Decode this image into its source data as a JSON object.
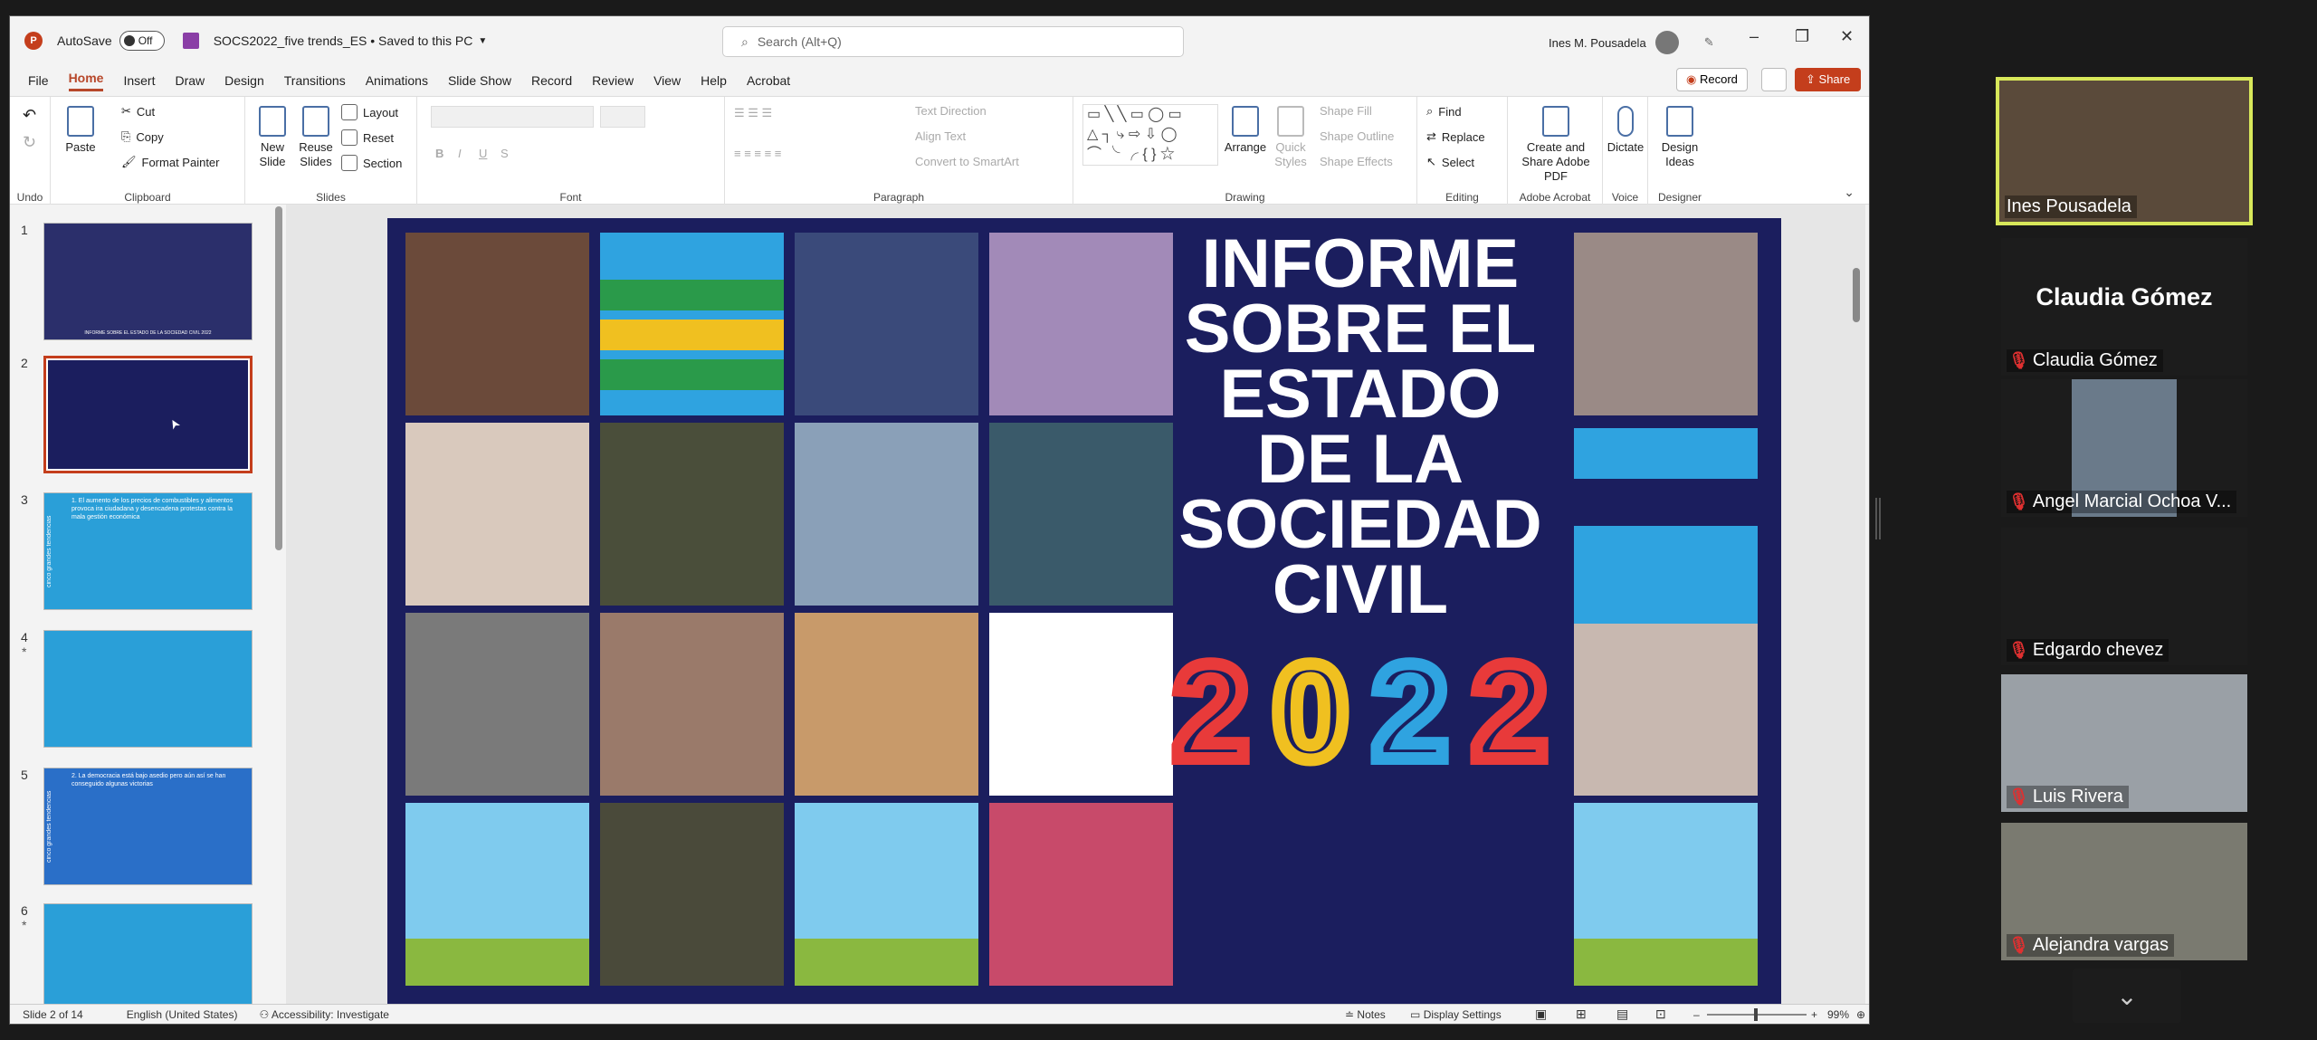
{
  "titlebar": {
    "autosave_label": "AutoSave",
    "autosave_state": "Off",
    "doc_title": "SOCS2022_five trends_ES • Saved to this PC",
    "search_placeholder": "Search (Alt+Q)",
    "user_name": "Ines M. Pousadela"
  },
  "menu": [
    "File",
    "Home",
    "Insert",
    "Draw",
    "Design",
    "Transitions",
    "Animations",
    "Slide Show",
    "Record",
    "Review",
    "View",
    "Help",
    "Acrobat"
  ],
  "menu_active": "Home",
  "actions": {
    "record": "Record",
    "share": "Share"
  },
  "ribbon": {
    "undo": "Undo",
    "clipboard": {
      "label": "Clipboard",
      "paste": "Paste",
      "cut": "Cut",
      "copy": "Copy",
      "format_painter": "Format Painter"
    },
    "slides": {
      "label": "Slides",
      "new_slide": "New Slide",
      "reuse": "Reuse Slides",
      "layout": "Layout",
      "reset": "Reset",
      "section": "Section"
    },
    "font": {
      "label": "Font"
    },
    "paragraph": {
      "label": "Paragraph",
      "text_direction": "Text Direction",
      "align_text": "Align Text",
      "convert_smartart": "Convert to SmartArt"
    },
    "drawing": {
      "label": "Drawing",
      "arrange": "Arrange",
      "quick_styles": "Quick Styles",
      "shape_fill": "Shape Fill",
      "shape_outline": "Shape Outline",
      "shape_effects": "Shape Effects"
    },
    "editing": {
      "label": "Editing",
      "find": "Find",
      "replace": "Replace",
      "select": "Select"
    },
    "adobe": {
      "label": "Adobe Acrobat",
      "create_share": "Create and Share Adobe PDF"
    },
    "voice": {
      "label": "Voice",
      "dictate": "Dictate"
    },
    "designer": {
      "label": "Designer",
      "design_ideas": "Design Ideas"
    }
  },
  "thumbnails": [
    {
      "num": "1",
      "star": false,
      "caption": "INFORME SOBRE EL ESTADO DE LA SOCIEDAD CIVIL 2022"
    },
    {
      "num": "2",
      "star": false,
      "caption": ""
    },
    {
      "num": "3",
      "star": false,
      "caption": "1. El aumento de los precios de combustibles y alimentos provoca ira ciudadana y desencadena protestas contra la mala gestión económica"
    },
    {
      "num": "4",
      "star": true,
      "caption": ""
    },
    {
      "num": "5",
      "star": false,
      "caption": "2. La democracia está bajo asedio pero aún así se han conseguido algunas victorias"
    },
    {
      "num": "6",
      "star": true,
      "caption": ""
    }
  ],
  "thumb_side_text": "cinco grandes tendencias",
  "slide": {
    "title_lines": [
      "INFORME",
      "SOBRE EL",
      "ESTADO",
      "DE LA",
      "SOCIEDAD",
      "CIVIL"
    ],
    "year_digits": [
      "2",
      "0",
      "2",
      "2"
    ]
  },
  "status": {
    "slide_pos": "Slide 2 of 14",
    "language": "English (United States)",
    "accessibility": "Accessibility: Investigate",
    "notes": "Notes",
    "display": "Display Settings",
    "zoom": "99%"
  },
  "participants": [
    {
      "name": "Ines Pousadela",
      "video": true,
      "muted": false,
      "speaking": true
    },
    {
      "name": "Claudia Gómez",
      "video": false,
      "muted": true,
      "big_name": "Claudia Gómez"
    },
    {
      "name": "Angel Marcial Ochoa V...",
      "video": true,
      "muted": true
    },
    {
      "name": "Edgardo chevez",
      "video": false,
      "muted": true
    },
    {
      "name": "Luis Rivera",
      "video": true,
      "muted": true
    },
    {
      "name": "Alejandra vargas",
      "video": true,
      "muted": true
    }
  ],
  "colors": {
    "accent": "#c43e1c",
    "slide_bg": "#1b1e5e",
    "speaker_border": "#d8e85a"
  }
}
